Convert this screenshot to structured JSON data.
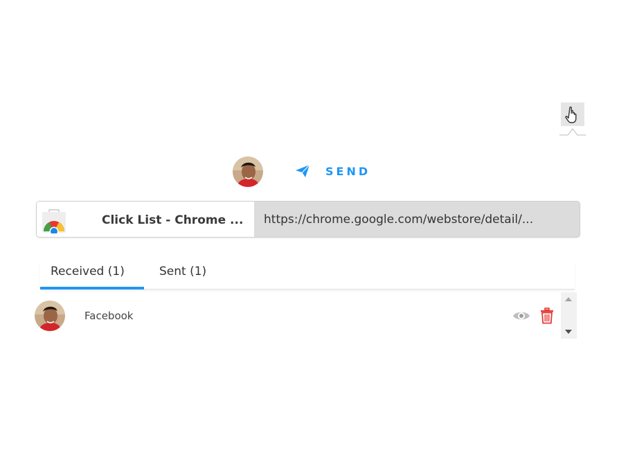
{
  "colors": {
    "accent": "#2196f3",
    "trash": "#e53935",
    "eye": "#9e9e9e",
    "card_url_bg": "#dcdcdc"
  },
  "toolbar": {
    "picker_icon": "hand-pointer-icon"
  },
  "header": {
    "avatar_icon": "user-avatar",
    "send_icon": "paper-plane-icon",
    "send_label": "SEND"
  },
  "link_card": {
    "favicon": "chrome-web-store-icon",
    "title": "Click List - Chrome ...",
    "url": "https://chrome.google.com/webstore/detail/..."
  },
  "tabs": [
    {
      "label": "Received (1)",
      "active": true
    },
    {
      "label": "Sent (1)",
      "active": false
    }
  ],
  "items": [
    {
      "label": "Facebook",
      "avatar_icon": "user-avatar",
      "view_icon": "eye-icon",
      "delete_icon": "trash-icon"
    }
  ],
  "scrollbar": {
    "up_icon": "arrow-up-icon",
    "down_icon": "arrow-down-icon"
  }
}
